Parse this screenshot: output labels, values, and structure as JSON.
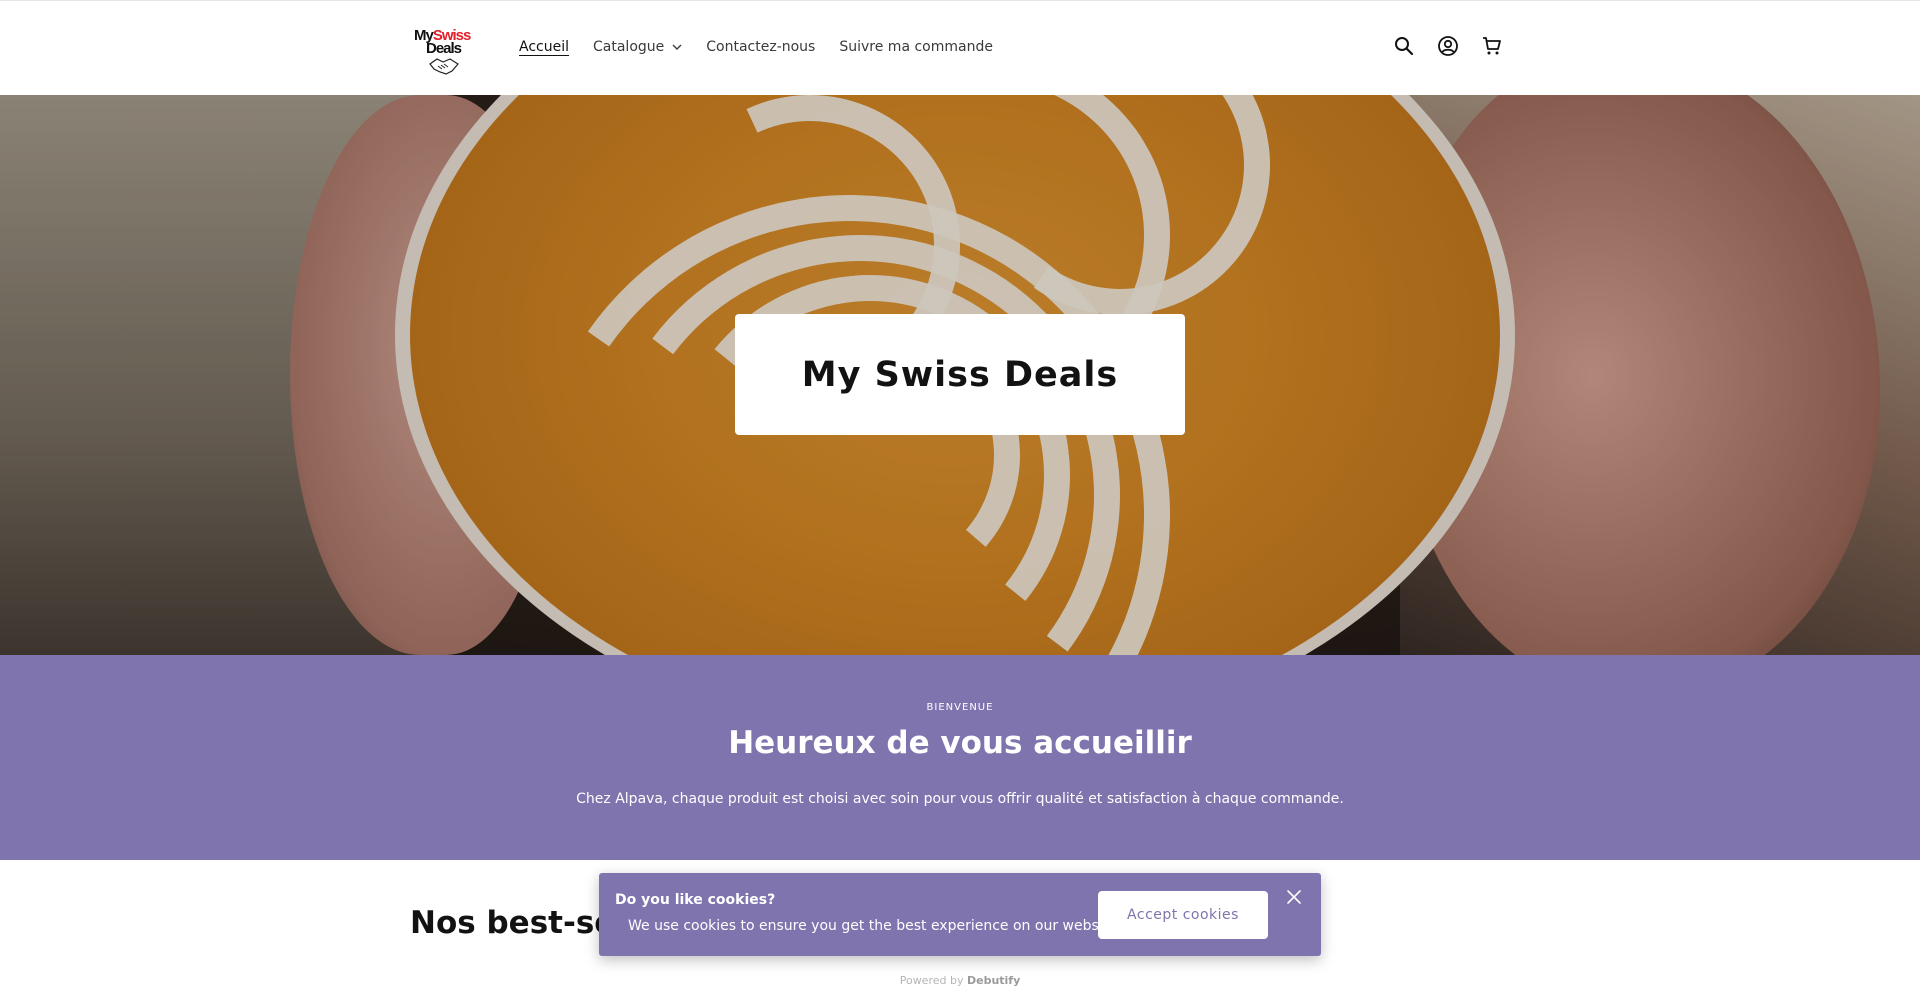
{
  "header": {
    "logo": {
      "line1_black": "My",
      "line1_red": "Swiss",
      "line2": "Deals"
    },
    "nav": [
      {
        "label": "Accueil",
        "active": true
      },
      {
        "label": "Catalogue",
        "has_dropdown": true
      },
      {
        "label": "Contactez-nous"
      },
      {
        "label": "Suivre ma commande"
      }
    ],
    "icons": [
      "search-icon",
      "account-icon",
      "cart-icon"
    ]
  },
  "hero": {
    "title": "My Swiss Deals"
  },
  "welcome": {
    "kicker": "BIENVENUE",
    "headline": "Heureux de vous accueillir",
    "description": "Chez Alpava, chaque produit est choisi avec soin pour vous offrir qualité et satisfaction à chaque commande."
  },
  "bestsellers": {
    "title": "Nos best-sel"
  },
  "cookie_banner": {
    "title": "Do you like cookies?",
    "text": "We use cookies to ensure you get the best experience on our website.",
    "accept_label": "Accept cookies",
    "powered_prefix": "Powered by",
    "powered_brand": "Debutify"
  },
  "colors": {
    "accent": "#7f74ae",
    "logo_red": "#e0202a",
    "text": "#121212"
  }
}
